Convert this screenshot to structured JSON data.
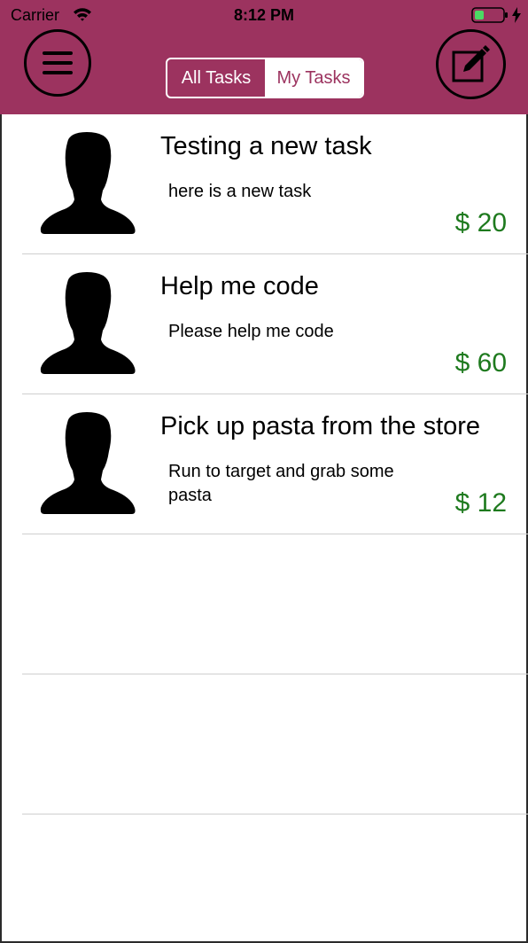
{
  "status_bar": {
    "carrier": "Carrier",
    "time": "8:12 PM"
  },
  "header": {
    "tabs": [
      {
        "label": "All Tasks",
        "selected": true
      },
      {
        "label": "My Tasks",
        "selected": false
      }
    ],
    "accent_color": "#9c335f"
  },
  "tasks": [
    {
      "title": "Testing a new task",
      "description": "here is a new task",
      "price": "$ 20"
    },
    {
      "title": "Help me code",
      "description": "Please help me code",
      "price": "$ 60"
    },
    {
      "title": "Pick up pasta from the store",
      "description": "Run to target and grab some pasta",
      "price": "$ 12"
    }
  ],
  "price_color": "#1e7a1e"
}
